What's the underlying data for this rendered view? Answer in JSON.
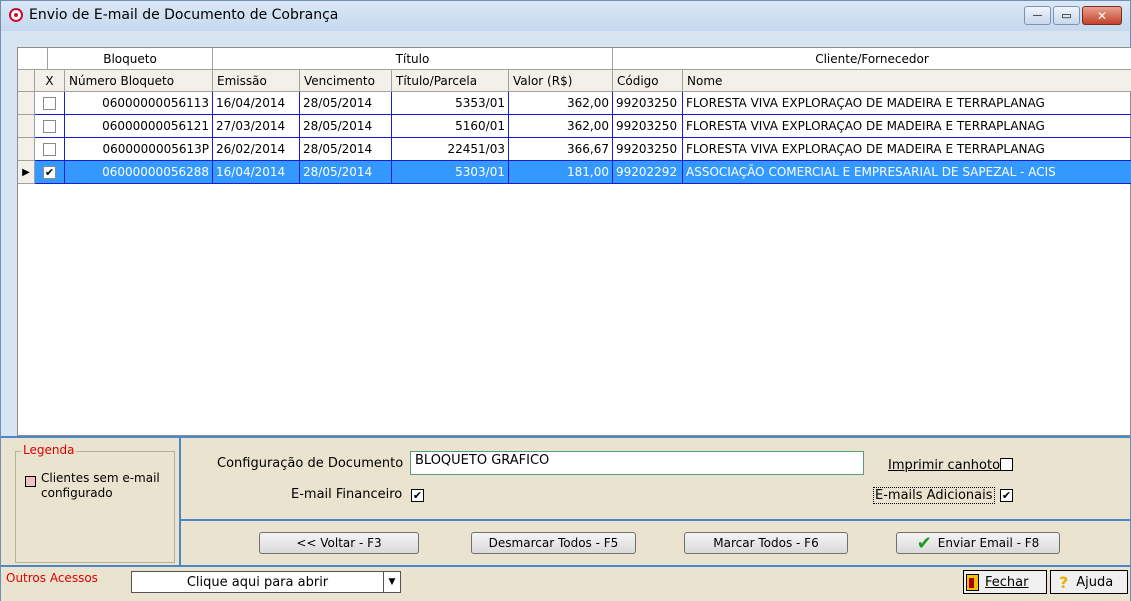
{
  "window": {
    "title": "Envio de E-mail de Documento de Cobrança",
    "minimize_label": "—",
    "maximize_label": "▭",
    "close_label": "✕"
  },
  "grid": {
    "group_headers": {
      "bloqueto": "Bloqueto",
      "titulo": "Título",
      "cliente": "Cliente/Fornecedor"
    },
    "columns": {
      "x": "X",
      "numero": "Número Bloqueto",
      "emissao": "Emissão",
      "vencimento": "Vencimento",
      "parcela": "Título/Parcela",
      "valor": "Valor (R$)",
      "codigo": "Código",
      "nome": "Nome"
    },
    "rows": [
      {
        "checked": false,
        "mark": "",
        "numero": "06000000056113",
        "emissao": "16/04/2014",
        "vencimento": "28/05/2014",
        "parcela": "5353/01",
        "valor": "362,00",
        "codigo": "99203250",
        "nome": "FLORESTA VIVA EXPLORAÇAO DE MADEIRA E TERRAPLANAG"
      },
      {
        "checked": false,
        "mark": "",
        "numero": "06000000056121",
        "emissao": "27/03/2014",
        "vencimento": "28/05/2014",
        "parcela": "5160/01",
        "valor": "362,00",
        "codigo": "99203250",
        "nome": "FLORESTA VIVA EXPLORAÇAO DE MADEIRA E TERRAPLANAG"
      },
      {
        "checked": false,
        "mark": "",
        "numero": "0600000005613P",
        "emissao": "26/02/2014",
        "vencimento": "28/05/2014",
        "parcela": "22451/03",
        "valor": "366,67",
        "codigo": "99203250",
        "nome": "FLORESTA VIVA EXPLORAÇAO DE MADEIRA E TERRAPLANAG"
      },
      {
        "checked": true,
        "mark": "✔",
        "numero": "06000000056288",
        "emissao": "16/04/2014",
        "vencimento": "28/05/2014",
        "parcela": "5303/01",
        "valor": "181,00",
        "codigo": "99202292",
        "nome": "ASSOCIAÇÃO COMERCIAL E EMPRESARIAL DE SAPEZAL - ACIS"
      }
    ],
    "row_pointer": "▶"
  },
  "legend": {
    "title": "Legenda",
    "item": "Clientes sem e-mail configurado"
  },
  "form": {
    "config_label": "Configuração de Documento",
    "config_value": "BLOQUETO GRAFICO",
    "email_fin_label": "E-mail Financeiro",
    "email_fin_mark": "✔",
    "imprimir_label": "Imprimir canhoto",
    "imprimir_mark": "",
    "emails_adic_label": "E-mails Adicionais",
    "emails_adic_mark": "✔"
  },
  "buttons": {
    "voltar": "<< Voltar - F3",
    "desmarcar": "Desmarcar Todos - F5",
    "marcar": "Marcar Todos - F6",
    "enviar": "Enviar Email - F8"
  },
  "footer": {
    "outros_label": "Outros Acessos",
    "combo_value": "Clique aqui para abrir",
    "combo_arrow": "▼",
    "fechar": "Fechar",
    "ajuda": "Ajuda"
  },
  "colors": {
    "selected_row": "#3399ff",
    "grid_lines": "#1b1bd8",
    "legend_red": "#e00000",
    "panel_bg": "#e9e3cf"
  }
}
